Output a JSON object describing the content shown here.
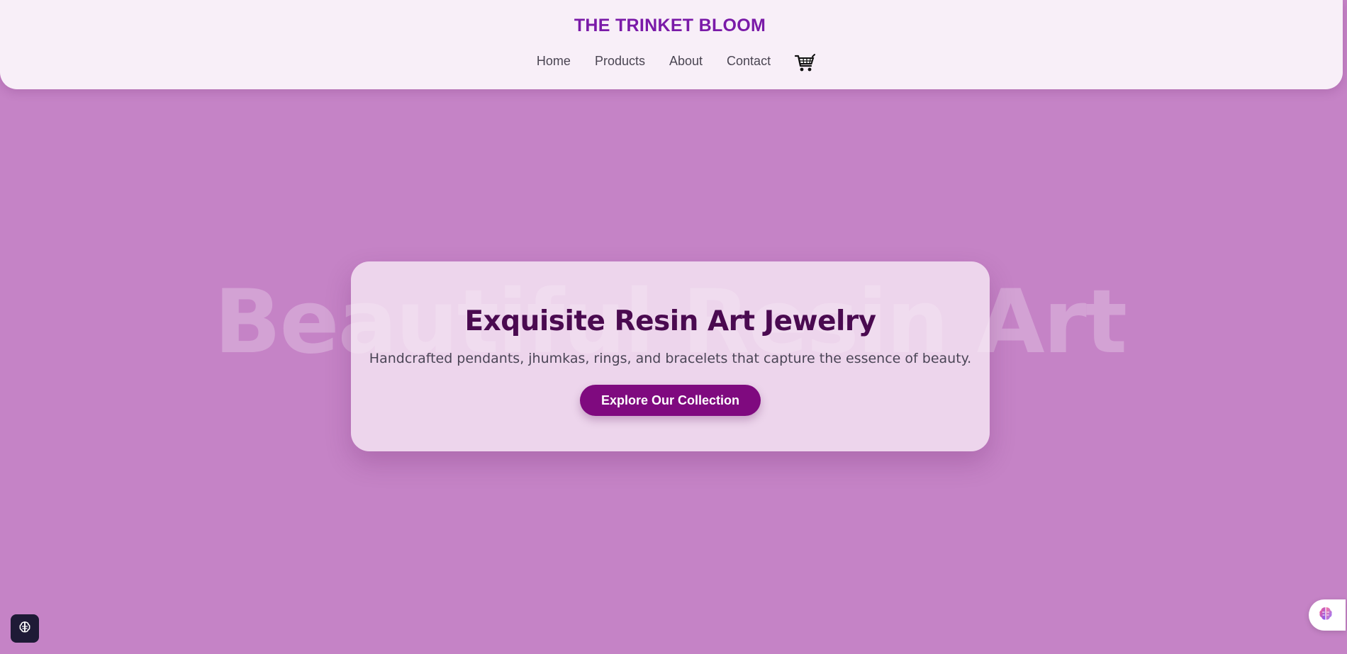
{
  "header": {
    "brand": "THE TRINKET BLOOM",
    "nav": [
      {
        "label": "Home"
      },
      {
        "label": "Products"
      },
      {
        "label": "About"
      },
      {
        "label": "Contact"
      }
    ],
    "cart_icon": "shopping-cart-icon"
  },
  "hero": {
    "watermark": "Beautiful Resin Art",
    "title": "Exquisite Resin Art Jewelry",
    "subtitle": "Handcrafted pendants, jhumkas, rings, and bracelets that capture the essence of beauty.",
    "cta_label": "Explore Our Collection"
  },
  "widgets": {
    "left_icon": "brain-icon",
    "right_icon": "brain-icon"
  },
  "colors": {
    "background": "#c583c6",
    "header_bg": "#f8eff8",
    "brand": "#7a1aa8",
    "hero_title": "#4a0a50",
    "cta_bg": "#7f0a7f"
  }
}
